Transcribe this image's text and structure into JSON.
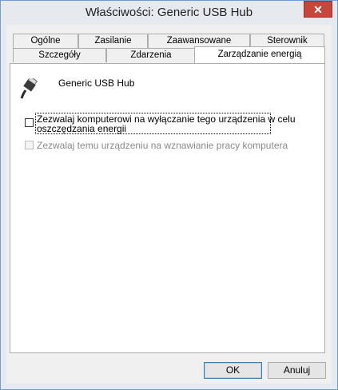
{
  "window": {
    "title": "Właściwości: Generic USB Hub",
    "close_glyph": "✕"
  },
  "tabs": {
    "row1": [
      {
        "label": "Ogólne"
      },
      {
        "label": "Zasilanie"
      },
      {
        "label": "Zaawansowane"
      },
      {
        "label": "Sterownik"
      }
    ],
    "row2": [
      {
        "label": "Szczegóły"
      },
      {
        "label": "Zdarzenia"
      },
      {
        "label": "Zarządzanie energią",
        "active": true
      }
    ]
  },
  "device": {
    "icon": "usb-plug-icon",
    "name": "Generic USB Hub"
  },
  "options": {
    "allow_power_off": {
      "checked": false,
      "line1": "Zezwalaj komputerowi na wyłączanie tego urządzenia w celu",
      "line2": "oszczędzania energii"
    },
    "allow_wake": {
      "checked": false,
      "enabled": false,
      "label": "Zezwalaj temu urządzeniu na wznawianie pracy komputera"
    }
  },
  "buttons": {
    "ok": "OK",
    "cancel": "Anuluj"
  }
}
